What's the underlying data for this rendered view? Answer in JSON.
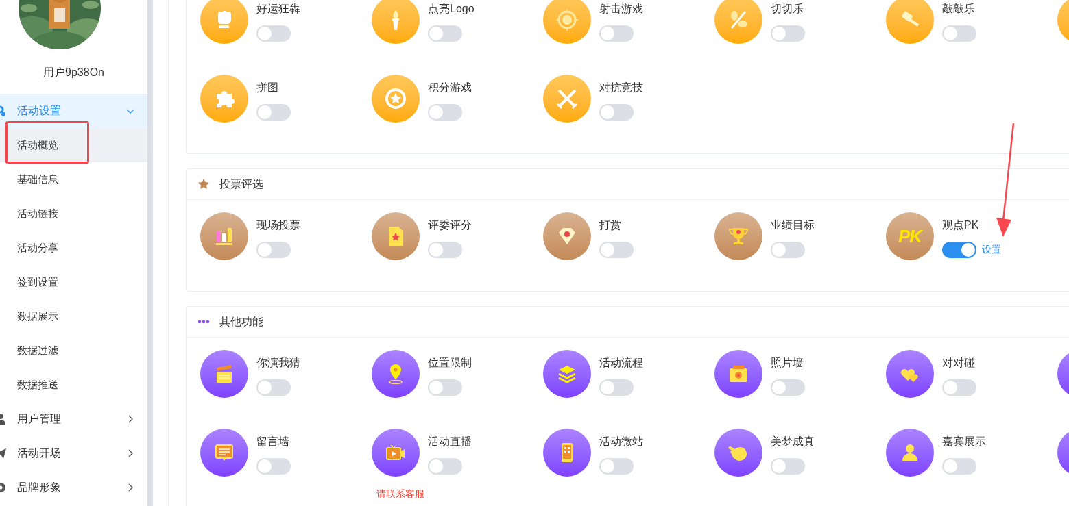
{
  "sidebar": {
    "user": {
      "name": "用户9p38On"
    },
    "menu": [
      {
        "label": "活动设置",
        "selected": true,
        "expanded": true,
        "children": [
          {
            "label": "活动概览",
            "selected": true
          },
          {
            "label": "基础信息",
            "selected": false
          },
          {
            "label": "活动链接",
            "selected": false
          },
          {
            "label": "活动分享",
            "selected": false
          },
          {
            "label": "签到设置",
            "selected": false
          },
          {
            "label": "数据展示",
            "selected": false
          },
          {
            "label": "数据过滤",
            "selected": false
          },
          {
            "label": "数据推送",
            "selected": false
          }
        ]
      },
      {
        "label": "用户管理",
        "selected": false,
        "expanded": false
      },
      {
        "label": "活动开场",
        "selected": false,
        "expanded": false
      },
      {
        "label": "品牌形象",
        "selected": false,
        "expanded": false
      }
    ]
  },
  "sections": [
    {
      "items": [
        {
          "kind": "feature",
          "label": "好运狂犇",
          "on": false
        },
        {
          "kind": "feature",
          "label": "点亮Logo",
          "on": false
        },
        {
          "kind": "feature",
          "label": "射击游戏",
          "on": false
        },
        {
          "kind": "feature",
          "label": "切切乐",
          "on": false
        },
        {
          "kind": "feature",
          "label": "敲敲乐",
          "on": false
        },
        {
          "kind": "cut-off"
        },
        {
          "kind": "feature",
          "label": "拼图",
          "on": false
        },
        {
          "kind": "feature",
          "label": "积分游戏",
          "on": false
        },
        {
          "kind": "feature",
          "label": "对抗竞技",
          "on": false
        }
      ]
    },
    {
      "title": "投票评选",
      "items": [
        {
          "kind": "feature",
          "label": "现场投票",
          "on": false
        },
        {
          "kind": "feature",
          "label": "评委评分",
          "on": false
        },
        {
          "kind": "feature",
          "label": "打赏",
          "on": false
        },
        {
          "kind": "feature",
          "label": "业绩目标",
          "on": false
        },
        {
          "kind": "feature",
          "label": "观点PK",
          "on": true,
          "link": "设置",
          "icon_text": "PK"
        }
      ]
    },
    {
      "title": "其他功能",
      "items": [
        {
          "kind": "feature",
          "label": "你演我猜",
          "on": false
        },
        {
          "kind": "feature",
          "label": "位置限制",
          "on": false
        },
        {
          "kind": "feature",
          "label": "活动流程",
          "on": false
        },
        {
          "kind": "feature",
          "label": "照片墙",
          "on": false
        },
        {
          "kind": "feature",
          "label": "对对碰",
          "on": false
        },
        {
          "kind": "cut-off"
        },
        {
          "kind": "feature",
          "label": "留言墙",
          "on": false
        },
        {
          "kind": "feature",
          "label": "活动直播",
          "on": false,
          "note": "请联系客服"
        },
        {
          "kind": "feature",
          "label": "活动微站",
          "on": false
        },
        {
          "kind": "feature",
          "label": "美梦成真",
          "on": false
        },
        {
          "kind": "feature",
          "label": "嘉宾展示",
          "on": false
        },
        {
          "kind": "cut-off"
        }
      ]
    }
  ]
}
